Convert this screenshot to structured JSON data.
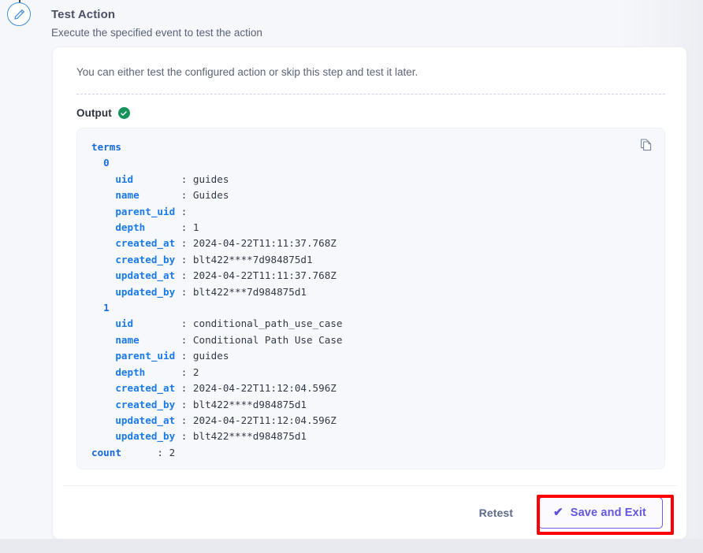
{
  "step": {
    "icon": "pencil-icon",
    "title": "Test Action",
    "subtitle": "Execute the specified event to test the action"
  },
  "card": {
    "intro": "You can either test the configured action or skip this step and test it later.",
    "output": {
      "label": "Output",
      "status_icon": "green-check-circle-icon",
      "copy_icon": "copy-icon",
      "code": "terms\n  0\n    uid        : guides\n    name       : Guides\n    parent_uid :\n    depth      : 1\n    created_at : 2024-04-22T11:11:37.768Z\n    created_by : blt422****7d984875d1\n    updated_at : 2024-04-22T11:11:37.768Z\n    updated_by : blt422***7d984875d1\n  1\n    uid        : conditional_path_use_case\n    name       : Conditional Path Use Case\n    parent_uid : guides\n    depth      : 2\n    created_at : 2024-04-22T11:12:04.596Z\n    created_by : blt422****d984875d1\n    updated_at : 2024-04-22T11:12:04.596Z\n    updated_by : blt422****d984875d1\ncount        : 2"
    },
    "footer": {
      "retest_label": "Retest",
      "save_exit_label": "Save and Exit",
      "save_exit_check": "✔"
    }
  },
  "colors": {
    "accent_purple": "#6c5ce7",
    "success_green": "#16935a",
    "highlight_red": "#fb0007",
    "step_blue": "#3f8fe0",
    "code_key_blue": "#1669d8",
    "page_background": "#f5f7fb"
  },
  "output_rows": [
    {
      "key": "terms",
      "indent": 0,
      "value": ""
    },
    {
      "key": "0",
      "indent": 1,
      "value": ""
    },
    {
      "key": "uid",
      "indent": 2,
      "value": "guides"
    },
    {
      "key": "name",
      "indent": 2,
      "value": "Guides"
    },
    {
      "key": "parent_uid",
      "indent": 2,
      "value": ""
    },
    {
      "key": "depth",
      "indent": 2,
      "value": "1"
    },
    {
      "key": "created_at",
      "indent": 2,
      "value": "2024-04-22T11:11:37.768Z"
    },
    {
      "key": "created_by",
      "indent": 2,
      "value": "blt422****7d984875d1"
    },
    {
      "key": "updated_at",
      "indent": 2,
      "value": "2024-04-22T11:11:37.768Z"
    },
    {
      "key": "updated_by",
      "indent": 2,
      "value": "blt422***7d984875d1"
    },
    {
      "key": "1",
      "indent": 1,
      "value": ""
    },
    {
      "key": "uid",
      "indent": 2,
      "value": "conditional_path_use_case"
    },
    {
      "key": "name",
      "indent": 2,
      "value": "Conditional Path Use Case"
    },
    {
      "key": "parent_uid",
      "indent": 2,
      "value": "guides"
    },
    {
      "key": "depth",
      "indent": 2,
      "value": "2"
    },
    {
      "key": "created_at",
      "indent": 2,
      "value": "2024-04-22T11:12:04.596Z"
    },
    {
      "key": "created_by",
      "indent": 2,
      "value": "blt422****d984875d1"
    },
    {
      "key": "updated_at",
      "indent": 2,
      "value": "2024-04-22T11:12:04.596Z"
    },
    {
      "key": "updated_by",
      "indent": 2,
      "value": "blt422****d984875d1"
    },
    {
      "key": "count",
      "indent": 0,
      "value": "2"
    }
  ]
}
